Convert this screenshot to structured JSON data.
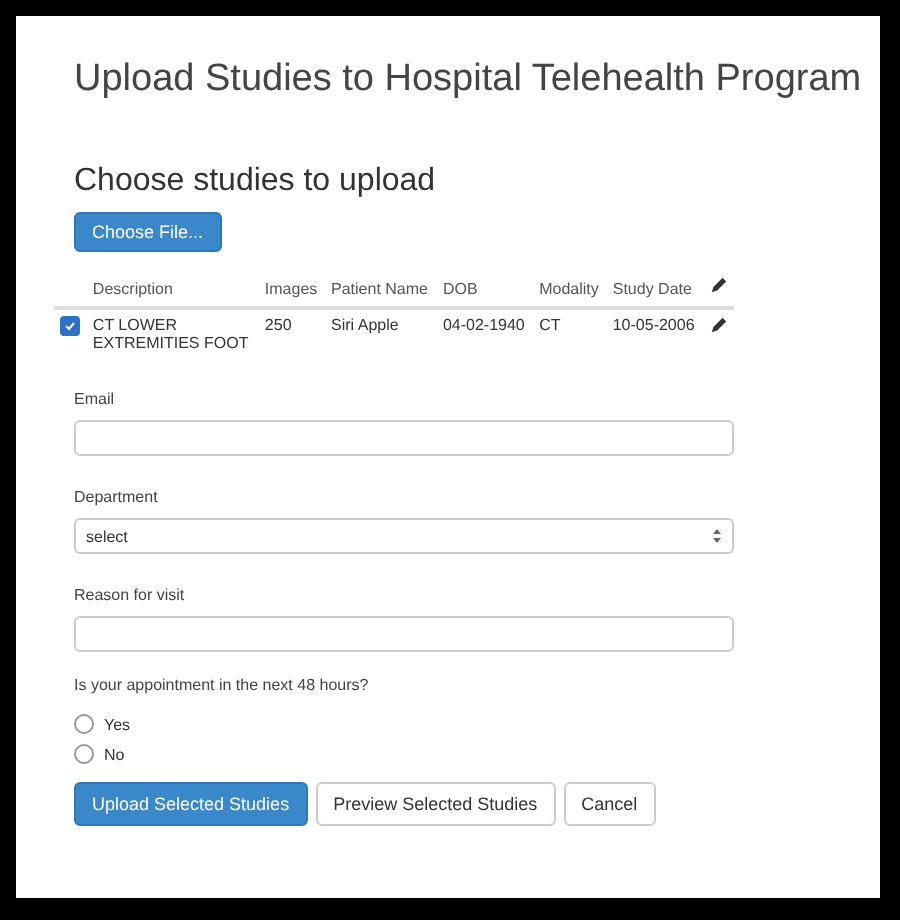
{
  "title": "Upload Studies to Hospital Telehealth Program",
  "section_title": "Choose studies to upload",
  "choose_button": "Choose File...",
  "table": {
    "columns": [
      "Description",
      "Images",
      "Patient Name",
      "DOB",
      "Modality",
      "Study Date"
    ],
    "rows": [
      {
        "checked": true,
        "cells": [
          "CT LOWER EXTREMITIES FOOT",
          "250",
          "Siri Apple",
          "04-02-1940",
          "CT",
          "10-05-2006"
        ]
      }
    ]
  },
  "fields": [
    {
      "kind": "text",
      "label": "Email"
    },
    {
      "kind": "select",
      "label": "Department",
      "value": "select"
    },
    {
      "kind": "text",
      "label": "Reason for visit"
    }
  ],
  "question": "Is your appointment in the next 48 hours?",
  "options": [
    {
      "label": "Yes",
      "selected": false
    },
    {
      "label": "No",
      "selected": false
    }
  ],
  "buttons": [
    {
      "label": "Upload Selected Studies",
      "kind": "primary"
    },
    {
      "label": "Preview Selected Studies",
      "kind": "default"
    },
    {
      "label": "Cancel",
      "kind": "default"
    }
  ]
}
